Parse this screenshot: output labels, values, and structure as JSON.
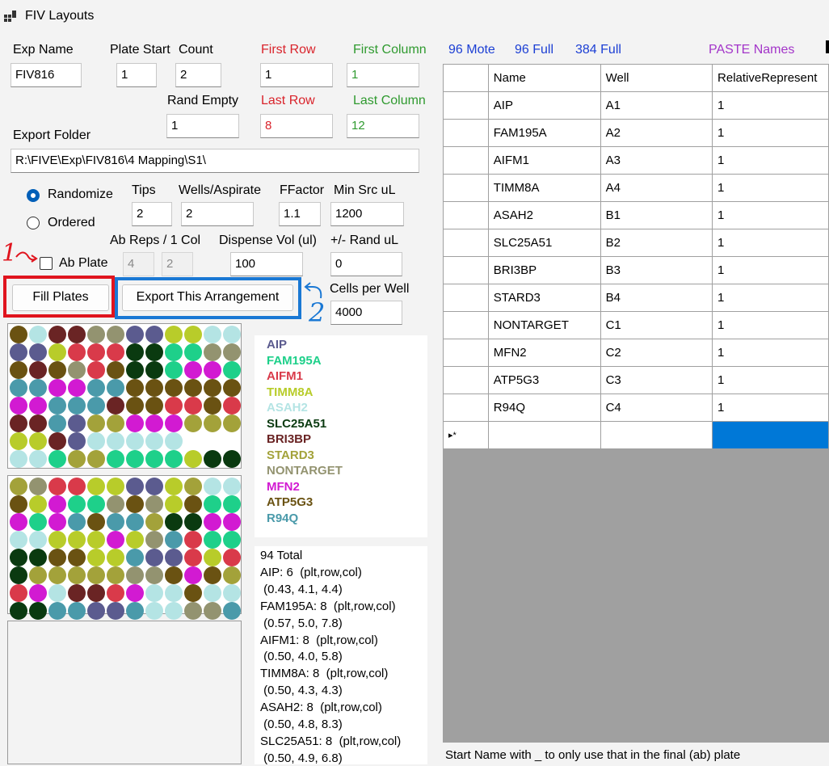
{
  "window": {
    "title": "FIV Layouts",
    "icon": "app-grid-icon"
  },
  "labels": {
    "exp_name": "Exp Name",
    "plate_start": "Plate Start",
    "count": "Count",
    "first_row": "First Row",
    "first_column": "First Column",
    "rand_empty": "Rand Empty",
    "last_row": "Last Row",
    "last_column": "Last Column",
    "export_folder": "Export Folder",
    "tips": "Tips",
    "wells_aspirate": "Wells/Aspirate",
    "ffactor": "FFactor",
    "min_src_ul": "Min Src uL",
    "ab_reps": "Ab Reps / 1 Col",
    "dispense_vol": "Dispense Vol (ul)",
    "rand_ul": "+/- Rand uL",
    "cells_per_well": "Cells per Well"
  },
  "links": {
    "mote96": "96 Mote",
    "full96": "96 Full",
    "full384": "384 Full",
    "paste_names": "PASTE Names"
  },
  "fields": {
    "exp_name": "FIV816",
    "plate_start": "1",
    "count": "2",
    "first_row": "1",
    "first_column": "1",
    "rand_empty": "1",
    "last_row": "8",
    "last_column": "12",
    "export_folder": "R:\\FIVE\\Exp\\FIV816\\4 Mapping\\S1\\",
    "tips": "2",
    "wells_aspirate": "2",
    "ffactor": "1.1",
    "min_src_ul": "1200",
    "ab_reps_a": "4",
    "ab_reps_b": "2",
    "dispense_vol": "100",
    "rand_ul": "0",
    "cells_per_well": "4000"
  },
  "options": {
    "randomize": "Randomize",
    "ordered": "Ordered",
    "ab_plate": "Ab Plate",
    "selected_mode": "randomize",
    "ab_plate_checked": false
  },
  "buttons": {
    "fill_plates": "Fill Plates",
    "export_arrangement": "Export This Arrangement"
  },
  "annotations": {
    "one": "1",
    "two": "2",
    "red": "#e0141e",
    "blue": "#1a78d4"
  },
  "legend": [
    {
      "name": "AIP",
      "color": "#5b5b8f"
    },
    {
      "name": "FAM195A",
      "color": "#1ed08a"
    },
    {
      "name": "AIFM1",
      "color": "#d93a4a"
    },
    {
      "name": "TIMM8A",
      "color": "#b8cc2a"
    },
    {
      "name": "ASAH2",
      "color": "#b4e4e4"
    },
    {
      "name": "SLC25A51",
      "color": "#0a3a10"
    },
    {
      "name": "BRI3BP",
      "color": "#6a2424"
    },
    {
      "name": "STARD3",
      "color": "#a3a23a"
    },
    {
      "name": "NONTARGET",
      "color": "#939370"
    },
    {
      "name": "MFN2",
      "color": "#d21ad2"
    },
    {
      "name": "ATP5G3",
      "color": "#6a5212"
    },
    {
      "name": "R94Q",
      "color": "#4a9aaa"
    }
  ],
  "plates": [
    [
      [
        10,
        4,
        6,
        6,
        8,
        8,
        0,
        0,
        3,
        3,
        4,
        4
      ],
      [
        0,
        0,
        3,
        2,
        2,
        2,
        5,
        5,
        1,
        1,
        8,
        8
      ],
      [
        10,
        6,
        10,
        8,
        2,
        10,
        5,
        5,
        1,
        9,
        9,
        1
      ],
      [
        11,
        11,
        9,
        9,
        11,
        11,
        10,
        10,
        10,
        10,
        10,
        10
      ],
      [
        9,
        9,
        11,
        11,
        11,
        6,
        10,
        10,
        2,
        2,
        10,
        2
      ],
      [
        6,
        6,
        11,
        0,
        7,
        7,
        9,
        9,
        9,
        7,
        7,
        7
      ],
      [
        3,
        3,
        6,
        0,
        4,
        4,
        4,
        4,
        4,
        -1,
        -1,
        -1
      ],
      [
        4,
        4,
        1,
        7,
        7,
        1,
        1,
        1,
        1,
        3,
        5,
        5
      ]
    ],
    [
      [
        7,
        8,
        2,
        2,
        3,
        3,
        0,
        0,
        3,
        7,
        4,
        4
      ],
      [
        10,
        3,
        9,
        1,
        1,
        8,
        10,
        8,
        3,
        10,
        1,
        1
      ],
      [
        9,
        1,
        9,
        11,
        10,
        11,
        11,
        7,
        5,
        5,
        9,
        9
      ],
      [
        4,
        4,
        3,
        3,
        3,
        9,
        3,
        8,
        11,
        2,
        1,
        1
      ],
      [
        5,
        5,
        10,
        10,
        3,
        3,
        11,
        0,
        0,
        2,
        3,
        2
      ],
      [
        5,
        7,
        7,
        7,
        7,
        7,
        8,
        8,
        10,
        9,
        10,
        7
      ],
      [
        2,
        9,
        4,
        6,
        6,
        2,
        9,
        4,
        4,
        10,
        4,
        4
      ],
      [
        5,
        5,
        11,
        11,
        0,
        0,
        11,
        4,
        4,
        8,
        8,
        11
      ]
    ]
  ],
  "stats": [
    "94 Total",
    "AIP: 6  (plt,row,col)",
    " (0.43, 4.1, 4.4)",
    "FAM195A: 8  (plt,row,col)",
    " (0.57, 5.0, 7.8)",
    "AIFM1: 8  (plt,row,col)",
    " (0.50, 4.0, 5.8)",
    "TIMM8A: 8  (plt,row,col)",
    " (0.50, 4.3, 4.3)",
    "ASAH2: 8  (plt,row,col)",
    " (0.50, 4.8, 8.3)",
    "SLC25A51: 8  (plt,row,col)",
    " (0.50, 4.9, 6.8)"
  ],
  "grid": {
    "columns": [
      "Name",
      "Well",
      "RelativeRepresent"
    ],
    "rows": [
      [
        "AIP",
        "A1",
        "1"
      ],
      [
        "FAM195A",
        "A2",
        "1"
      ],
      [
        "AIFM1",
        "A3",
        "1"
      ],
      [
        "TIMM8A",
        "A4",
        "1"
      ],
      [
        "ASAH2",
        "B1",
        "1"
      ],
      [
        "SLC25A51",
        "B2",
        "1"
      ],
      [
        "BRI3BP",
        "B3",
        "1"
      ],
      [
        "STARD3",
        "B4",
        "1"
      ],
      [
        "NONTARGET",
        "C1",
        "1"
      ],
      [
        "MFN2",
        "C2",
        "1"
      ],
      [
        "ATP5G3",
        "C3",
        "1"
      ],
      [
        "R94Q",
        "C4",
        "1"
      ]
    ],
    "new_row_marker": "▸*",
    "selected_color": "#0078d7"
  },
  "footer": "Start Name with _ to only use that in the final (ab) plate"
}
